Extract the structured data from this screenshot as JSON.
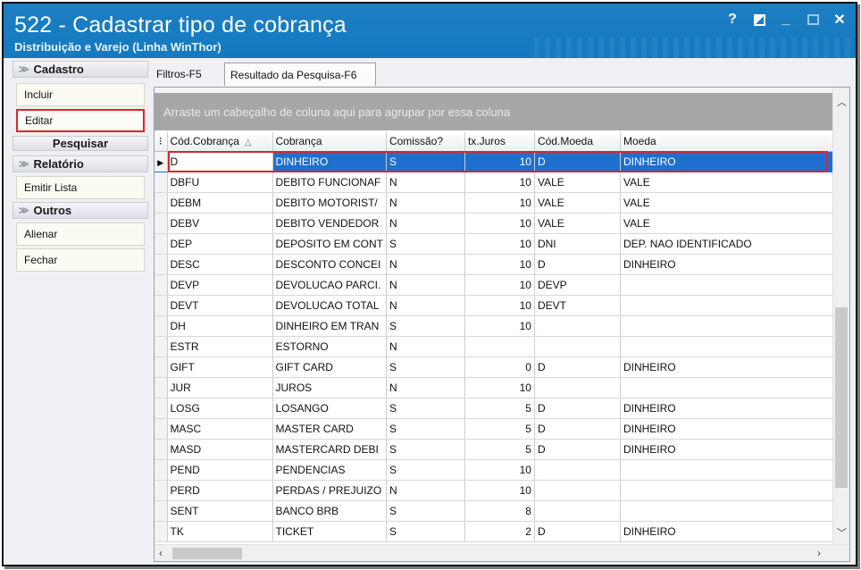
{
  "window": {
    "title": "522 - Cadastrar tipo de cobrança",
    "subtitle": "Distribuição e Varejo (Linha WinThor)",
    "controls": {
      "help": "?",
      "minimize": "_",
      "close": "✕"
    }
  },
  "left_panel": {
    "cadastro": {
      "header": "Cadastro",
      "incluir": "Incluir",
      "editar": "Editar"
    },
    "pesquisar": {
      "header": "Pesquisar"
    },
    "relatorio": {
      "header": "Relatório",
      "emitir": "Emitir Lista"
    },
    "outros": {
      "header": "Outros",
      "alienar": "Alienar",
      "fechar": "Fechar"
    }
  },
  "tabs": {
    "filtros": "Filtros-F5",
    "resultado": "Resultado da Pesquisa-F6"
  },
  "grid": {
    "group_hint": "Arraste um cabeçalho de coluna aqui para agrupar por essa coluna",
    "columns": [
      "Cód.Cobrança",
      "Cobrança",
      "Comissão?",
      "tx.Juros",
      "Cód.Moeda",
      "Moeda"
    ],
    "rows": [
      [
        "D",
        "DINHEIRO",
        "S",
        "10",
        "D",
        "DINHEIRO"
      ],
      [
        "DBFU",
        "DEBITO FUNCIONAF",
        "N",
        "10",
        "VALE",
        "VALE"
      ],
      [
        "DEBM",
        "DEBITO MOTORIST/",
        "N",
        "10",
        "VALE",
        "VALE"
      ],
      [
        "DEBV",
        "DEBITO VENDEDOR",
        "N",
        "10",
        "VALE",
        "VALE"
      ],
      [
        "DEP",
        "DEPOSITO EM CONT",
        "S",
        "10",
        "DNI",
        "DEP. NAO IDENTIFICADO"
      ],
      [
        "DESC",
        "DESCONTO CONCEI",
        "N",
        "10",
        "D",
        "DINHEIRO"
      ],
      [
        "DEVP",
        "DEVOLUCAO PARCI.",
        "N",
        "10",
        "DEVP",
        ""
      ],
      [
        "DEVT",
        "DEVOLUCAO TOTAL",
        "N",
        "10",
        "DEVT",
        ""
      ],
      [
        "DH",
        "DINHEIRO EM TRAN",
        "S",
        "10",
        "",
        ""
      ],
      [
        "ESTR",
        "ESTORNO",
        "N",
        "",
        "",
        ""
      ],
      [
        "GIFT",
        "GIFT CARD",
        "S",
        "0",
        "D",
        "DINHEIRO"
      ],
      [
        "JUR",
        "JUROS",
        "N",
        "10",
        "",
        ""
      ],
      [
        "LOSG",
        "LOSANGO",
        "S",
        "5",
        "D",
        "DINHEIRO"
      ],
      [
        "MASC",
        "MASTER CARD",
        "S",
        "5",
        "D",
        "DINHEIRO"
      ],
      [
        "MASD",
        "MASTERCARD DEBI",
        "S",
        "5",
        "D",
        "DINHEIRO"
      ],
      [
        "PEND",
        "PENDENCIAS",
        "S",
        "10",
        "",
        ""
      ],
      [
        "PERD",
        "PERDAS / PREJUIZO",
        "N",
        "10",
        "",
        ""
      ],
      [
        "SENT",
        "BANCO BRB",
        "S",
        "8",
        "",
        ""
      ],
      [
        "TK",
        "TICKET",
        "S",
        "2",
        "D",
        "DINHEIRO"
      ]
    ],
    "selected_row": 0
  },
  "colors": {
    "titlebar": "#1479bf",
    "selection": "#1f6fd0",
    "highlight_box": "#d8262b",
    "group_bar": "#a7a7a7"
  }
}
